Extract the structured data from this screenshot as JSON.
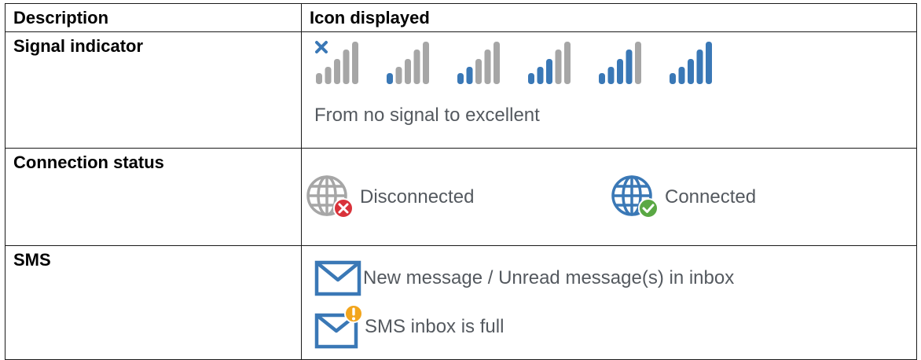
{
  "table": {
    "headers": {
      "description": "Description",
      "icon_displayed": "Icon displayed"
    },
    "rows": {
      "signal": {
        "description": "Signal indicator",
        "caption": "From no signal to excellent",
        "levels": [
          0,
          1,
          2,
          3,
          4,
          5
        ]
      },
      "connection": {
        "description": "Connection status",
        "disconnected_label": "Disconnected",
        "connected_label": "Connected"
      },
      "sms": {
        "description": "SMS",
        "new_message_label": "New message / Unread message(s) in inbox",
        "inbox_full_label": "SMS inbox is full"
      }
    }
  },
  "icons": {
    "signal": "signal-strength-icon",
    "no_signal_mark": "x-mark-icon",
    "disconnected": "globe-disconnected-icon",
    "connected": "globe-connected-icon",
    "envelope": "envelope-icon",
    "alert_badge": "exclamation-badge-icon"
  },
  "colors": {
    "active_bar": "#3a78b6",
    "inactive_bar": "#a6a6a6",
    "icon_text": "#54595f",
    "error_badge": "#d9323a",
    "ok_badge": "#5aa844",
    "warning_badge": "#f2a51c"
  }
}
